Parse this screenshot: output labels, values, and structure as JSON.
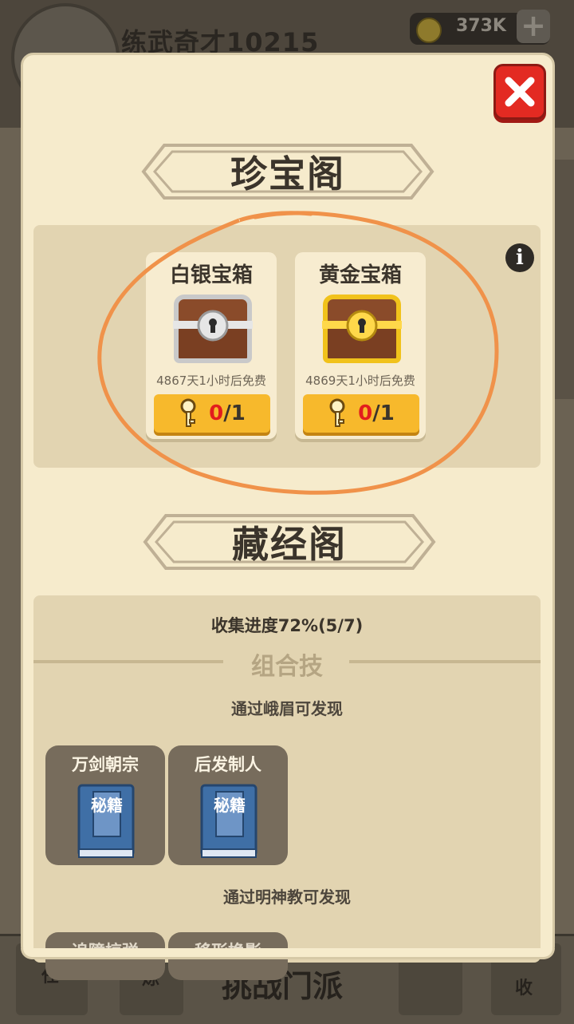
{
  "background": {
    "player_name": "练武奇才10215",
    "currency": "373K",
    "currency_icon": "coin-icon",
    "bottom_challenge_label": "挑战门派",
    "bottom_tab_labels": [
      "任",
      "炼",
      "收"
    ]
  },
  "modal": {
    "close_icon": "close-icon",
    "treasure": {
      "title": "珍宝阁",
      "info_icon": "info-icon",
      "info_label": "i",
      "chests": [
        {
          "name": "白银宝箱",
          "timer": "4867天1小时后免费",
          "key_have": "0",
          "key_total": "/1",
          "color": "#c9c9c9"
        },
        {
          "name": "黄金宝箱",
          "timer": "4869天1小时后免费",
          "key_have": "0",
          "key_total": "/1",
          "color": "#f1c21b"
        }
      ]
    },
    "scripture": {
      "title": "藏经阁",
      "progress": "收集进度72%(5/7)",
      "combo_label": "组合技",
      "groups": [
        {
          "discover": "通过峨眉可发现",
          "skills": [
            {
              "name": "万剑朝宗",
              "book_text": "秘籍"
            },
            {
              "name": "后发制人",
              "book_text": "秘籍"
            }
          ]
        },
        {
          "discover": "通过明神教可发现",
          "skills": [
            {
              "name": "追障掠弹"
            },
            {
              "name": "移形换影"
            }
          ]
        }
      ]
    }
  },
  "colors": {
    "modal_bg": "#f6ebcc",
    "panel_bg": "#e2d4b1",
    "button_yellow": "#f7b92c",
    "close_red": "#e32a22",
    "annotation_orange": "#f0924a"
  }
}
